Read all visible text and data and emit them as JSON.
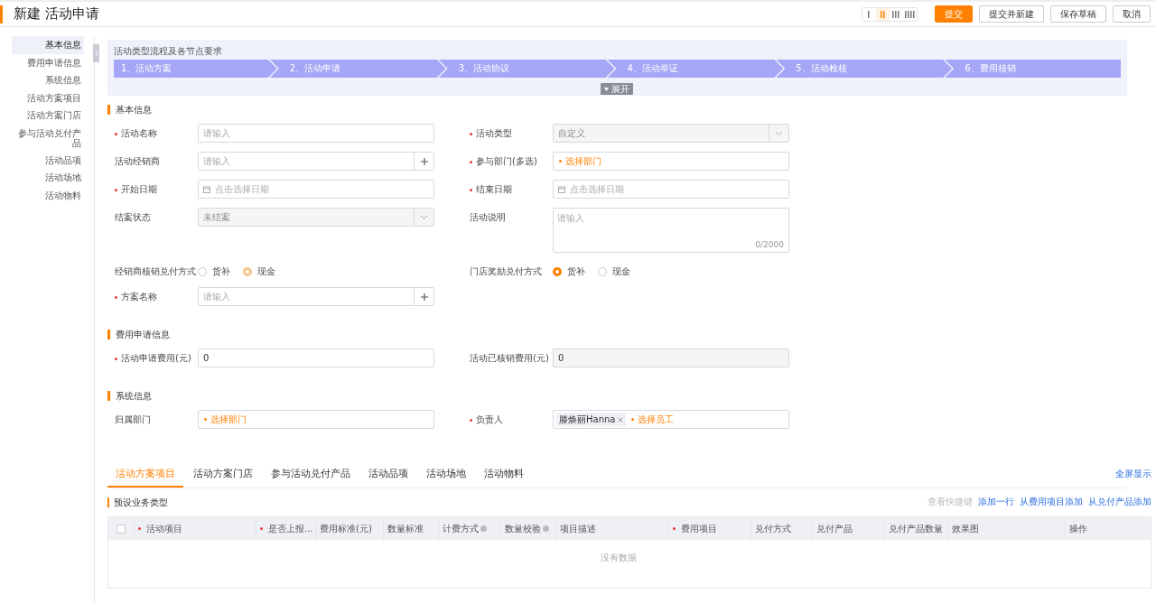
{
  "header": {
    "title": "新建 活动申请",
    "layouts": [
      {
        "selected": false
      },
      {
        "selected": true
      },
      {
        "selected": false
      },
      {
        "selected": false
      }
    ],
    "buttons": [
      {
        "label": "提交",
        "kind": "primary"
      },
      {
        "label": "提交并新建",
        "kind": "default"
      },
      {
        "label": "保存草稿",
        "kind": "default"
      },
      {
        "label": "取消",
        "kind": "default"
      }
    ]
  },
  "sidebar": {
    "items": [
      {
        "label": "基本信息",
        "selected": true
      },
      {
        "label": "费用申请信息",
        "selected": false
      },
      {
        "label": "系统信息",
        "selected": false
      },
      {
        "label": "活动方案项目",
        "selected": false
      },
      {
        "label": "活动方案门店",
        "selected": false
      },
      {
        "label": "参与活动兑付产品",
        "selected": false
      },
      {
        "label": "活动品项",
        "selected": false
      },
      {
        "label": "活动场地",
        "selected": false
      },
      {
        "label": "活动物料",
        "selected": false
      }
    ]
  },
  "process": {
    "title": "活动类型流程及各节点要求",
    "steps": [
      "1、活动方案",
      "2、活动申请",
      "3、活动协议",
      "4、活动举证",
      "5、活动检核",
      "6、费用核销"
    ],
    "toggle": "展开"
  },
  "sections": [
    {
      "title": "基本信息",
      "rows": [
        [
          {
            "label": "活动名称",
            "required": true,
            "kind": "input",
            "placeholder": "请输入"
          },
          {
            "label": "活动类型",
            "required": true,
            "kind": "select",
            "value": "自定义"
          }
        ],
        [
          {
            "label": "活动经销商",
            "required": false,
            "kind": "addon",
            "placeholder": "请输入"
          },
          {
            "label": "参与部门(多选)",
            "required": true,
            "kind": "picker",
            "placeholder": "选择部门"
          }
        ],
        [
          {
            "label": "开始日期",
            "required": true,
            "kind": "date",
            "placeholder": "点击选择日期"
          },
          {
            "label": "结束日期",
            "required": true,
            "kind": "date",
            "placeholder": "点击选择日期"
          }
        ],
        [
          {
            "label": "结案状态",
            "required": false,
            "kind": "select",
            "value": "未结案"
          },
          {
            "label": "活动说明",
            "required": false,
            "kind": "textarea",
            "placeholder": "请输入",
            "counter": "0/2000"
          }
        ],
        [
          {
            "label": "经销商核销兑付方式",
            "required": false,
            "kind": "radio",
            "disabled": true,
            "options": [
              {
                "label": "货补",
                "selected": false
              },
              {
                "label": "现金",
                "selected": true
              }
            ]
          },
          {
            "label": "门店奖励兑付方式",
            "required": false,
            "kind": "radio",
            "disabled": false,
            "options": [
              {
                "label": "货补",
                "selected": true
              },
              {
                "label": "现金",
                "selected": false
              }
            ]
          }
        ],
        [
          {
            "label": "方案名称",
            "required": true,
            "kind": "addon",
            "placeholder": "请输入"
          }
        ]
      ]
    },
    {
      "title": "费用申请信息",
      "rows": [
        [
          {
            "label": "活动申请费用(元)",
            "required": true,
            "kind": "input",
            "value": "0"
          },
          {
            "label": "活动已核销费用(元)",
            "required": false,
            "kind": "readonly",
            "value": "0"
          }
        ]
      ]
    },
    {
      "title": "系统信息",
      "rows": [
        [
          {
            "label": "归属部门",
            "required": false,
            "kind": "picker",
            "placeholder": "选择部门"
          },
          {
            "label": "负责人",
            "required": true,
            "kind": "picker",
            "tag": "滕焕丽Hanna",
            "placeholder": "选择员工"
          }
        ]
      ]
    }
  ],
  "detail_tabs": {
    "tabs": [
      {
        "label": "活动方案项目",
        "selected": true
      },
      {
        "label": "活动方案门店",
        "selected": false
      },
      {
        "label": "参与活动兑付产品",
        "selected": false
      },
      {
        "label": "活动品项",
        "selected": false
      },
      {
        "label": "活动场地",
        "selected": false
      },
      {
        "label": "活动物料",
        "selected": false
      }
    ],
    "fullscreen": "全屏显示"
  },
  "table": {
    "title": "预设业务类型",
    "actions": [
      {
        "label": "查看快捷键",
        "kind": "hint"
      },
      {
        "label": "添加一行",
        "kind": "link"
      },
      {
        "label": "从费用项目添加",
        "kind": "link"
      },
      {
        "label": "从兑付产品添加",
        "kind": "link"
      }
    ],
    "select_all": {
      "checked": false
    },
    "columns": [
      {
        "label": "活动项目",
        "required": true,
        "help": false
      },
      {
        "label": "是否上报...",
        "required": true,
        "help": false
      },
      {
        "label": "费用标准(元)",
        "required": false,
        "help": false
      },
      {
        "label": "数量标准",
        "required": false,
        "help": false
      },
      {
        "label": "计费方式",
        "required": false,
        "help": true
      },
      {
        "label": "数量校验",
        "required": false,
        "help": true
      },
      {
        "label": "项目描述",
        "required": false,
        "help": false
      },
      {
        "label": "费用项目",
        "required": true,
        "help": false
      },
      {
        "label": "兑付方式",
        "required": false,
        "help": false
      },
      {
        "label": "兑付产品",
        "required": false,
        "help": false
      },
      {
        "label": "兑付产品数量",
        "required": false,
        "help": false
      },
      {
        "label": "效果图",
        "required": false,
        "help": false
      },
      {
        "label": "操作",
        "required": false,
        "help": false
      }
    ],
    "empty": "没有数据"
  }
}
